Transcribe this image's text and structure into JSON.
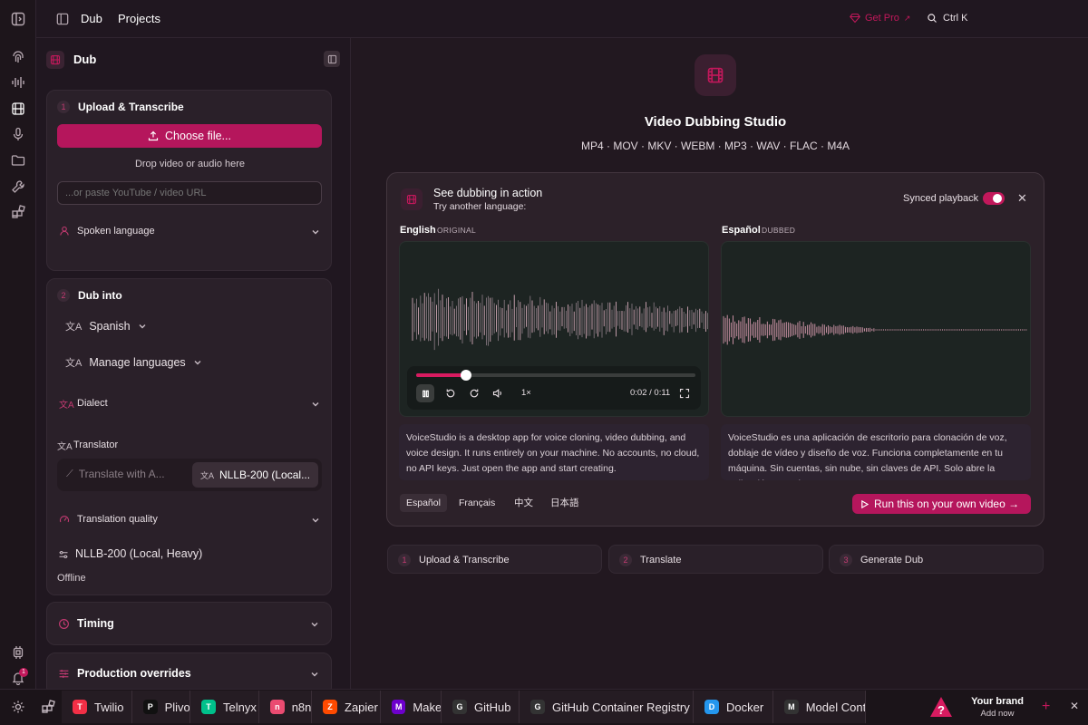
{
  "topbar": {
    "dub": "Dub",
    "projects": "Projects",
    "get_pro": "Get Pro",
    "search_shortcut": "Ctrl K"
  },
  "rail": {
    "notification_count": "1"
  },
  "panel": {
    "title": "Dub",
    "upload": {
      "step": "1",
      "title": "Upload & Transcribe",
      "choose_file": "Choose file...",
      "drop_hint": "Drop video or audio here",
      "url_placeholder": "...or paste YouTube / video URL",
      "spoken_language": "Spoken language"
    },
    "dub_into": {
      "step": "2",
      "title": "Dub into",
      "language": "Spanish",
      "manage_languages": "Manage languages",
      "dialect": "Dialect",
      "translator_label": "Translator",
      "translator_option_1": "Translate with A...",
      "translator_option_2": "NLLB-200 (Local...",
      "quality_label": "Translation quality",
      "quality_value": "NLLB-200 (Local, Heavy)",
      "quality_mode": "Offline"
    },
    "timing": "Timing",
    "production_overrides": "Production overrides"
  },
  "main": {
    "title": "Video Dubbing Studio",
    "formats": "MP4 · MOV · MKV · WEBM · MP3 · WAV · FLAC · M4A",
    "demo": {
      "title": "See dubbing in action",
      "subtitle": "Try another language:",
      "synced_label": "Synced playback",
      "synced_on": true,
      "original": {
        "lang": "English",
        "tag": "ORIGINAL",
        "text": "VoiceStudio is a desktop app for voice cloning, video dubbing, and voice design. It runs entirely on your machine. No accounts, no cloud, no API keys. Just open the app and start creating."
      },
      "dubbed": {
        "lang": "Español",
        "tag": "DUBBED",
        "text": "VoiceStudio es una aplicación de escritorio para clonación de voz, doblaje de vídeo y diseño de voz. Funciona completamente en tu máquina. Sin cuentas, sin nube, sin claves de API. Solo abre la aplicación y comienza a crear."
      },
      "player": {
        "speed": "1×",
        "time": "0:02 / 0:11",
        "progress": 0.18
      },
      "language_tabs": [
        "Español",
        "Français",
        "中文",
        "日本語"
      ],
      "active_tab": 0,
      "cta": "Run this on your own video →"
    },
    "steps": [
      {
        "num": "1",
        "label": "Upload & Transcribe"
      },
      {
        "num": "2",
        "label": "Translate"
      },
      {
        "num": "3",
        "label": "Generate Dub"
      }
    ]
  },
  "taskbar": {
    "items": [
      {
        "label": "Twilio",
        "icon": "twilio-icon",
        "color": "#f22f46"
      },
      {
        "label": "Plivo",
        "icon": "plivo-icon",
        "color": "#111111"
      },
      {
        "label": "Telnyx",
        "icon": "telnyx-icon",
        "color": "#00c08b"
      },
      {
        "label": "n8n",
        "icon": "n8n-icon",
        "color": "#ea4b71"
      },
      {
        "label": "Zapier",
        "icon": "zapier-icon",
        "color": "#ff4a00"
      },
      {
        "label": "Make",
        "icon": "make-icon",
        "color": "#6d00cc"
      },
      {
        "label": "GitHub",
        "icon": "github-icon",
        "color": "#333333"
      },
      {
        "label": "GitHub Container Registry",
        "icon": "github-icon",
        "color": "#333333"
      },
      {
        "label": "Docker",
        "icon": "docker-icon",
        "color": "#2496ed"
      },
      {
        "label": "Model Cont",
        "icon": "mcp-icon",
        "color": "#333333"
      }
    ],
    "brand": {
      "title": "Your brand",
      "sub": "Add now"
    }
  },
  "colors": {
    "accent": "#b5165c",
    "bg": "#221820",
    "card": "#2a2029"
  }
}
